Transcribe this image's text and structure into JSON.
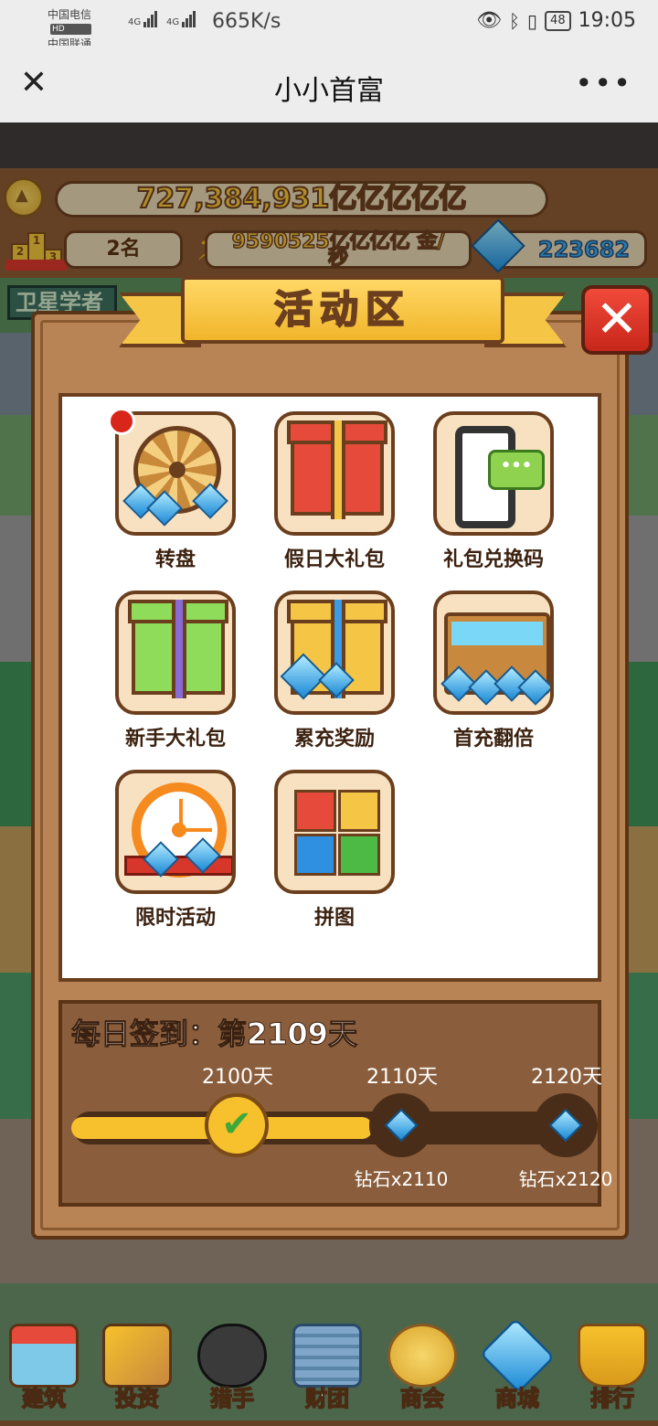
{
  "status_bar": {
    "carrier1": "中国电信",
    "carrier2": "中国联通",
    "hd": "HD",
    "net": "4G",
    "speed": "665K/s",
    "battery": "48",
    "time": "19:05"
  },
  "title_bar": {
    "title": "小小首富",
    "close_icon": "close-icon",
    "more_icon": "more-icon"
  },
  "hud": {
    "coins": "727,384,931亿亿亿亿亿",
    "rank": "2名",
    "income_line1": "9590525亿亿亿亿 金/",
    "income_line2": "秒",
    "diamonds": "223682",
    "side_tag": "卫星学者"
  },
  "modal": {
    "title": "活动区",
    "close_label": "✕",
    "activities": [
      {
        "label": "转盘",
        "icon": "roulette-icon",
        "badge": true
      },
      {
        "label": "假日大礼包",
        "icon": "holiday-gift-icon",
        "badge": false
      },
      {
        "label": "礼包兑换码",
        "icon": "phone-message-icon",
        "badge": false
      },
      {
        "label": "新手大礼包",
        "icon": "newbie-gift-icon",
        "badge": false
      },
      {
        "label": "累充奖励",
        "icon": "recharge-reward-icon",
        "badge": false
      },
      {
        "label": "首充翻倍",
        "icon": "treasure-chest-icon",
        "badge": false
      },
      {
        "label": "限时活动",
        "icon": "clock-icon",
        "badge": false
      },
      {
        "label": "拼图",
        "icon": "puzzle-icon",
        "badge": false
      }
    ]
  },
  "signin": {
    "title": "每日签到：第2109天",
    "progress": 0.5,
    "milestones": [
      {
        "day": "2100天",
        "reward": "",
        "done": true
      },
      {
        "day": "2110天",
        "reward": "钻石x2110",
        "done": false
      },
      {
        "day": "2120天",
        "reward": "钻石x2120",
        "done": false
      }
    ]
  },
  "bottom_nav": [
    {
      "label": "建筑",
      "icon": "shop-icon"
    },
    {
      "label": "投资",
      "icon": "gavel-icon"
    },
    {
      "label": "猎手",
      "icon": "hunters-icon"
    },
    {
      "label": "财团",
      "icon": "building-icon"
    },
    {
      "label": "商会",
      "icon": "chamber-emblem-icon"
    },
    {
      "label": "商城",
      "icon": "diamond-shop-icon"
    },
    {
      "label": "排行",
      "icon": "trophy-icon"
    }
  ],
  "colors": {
    "accent_gold": "#f6c12c",
    "panel_brown": "#b98455",
    "close_red": "#d9261b",
    "diamond_blue": "#1c8ad6"
  }
}
